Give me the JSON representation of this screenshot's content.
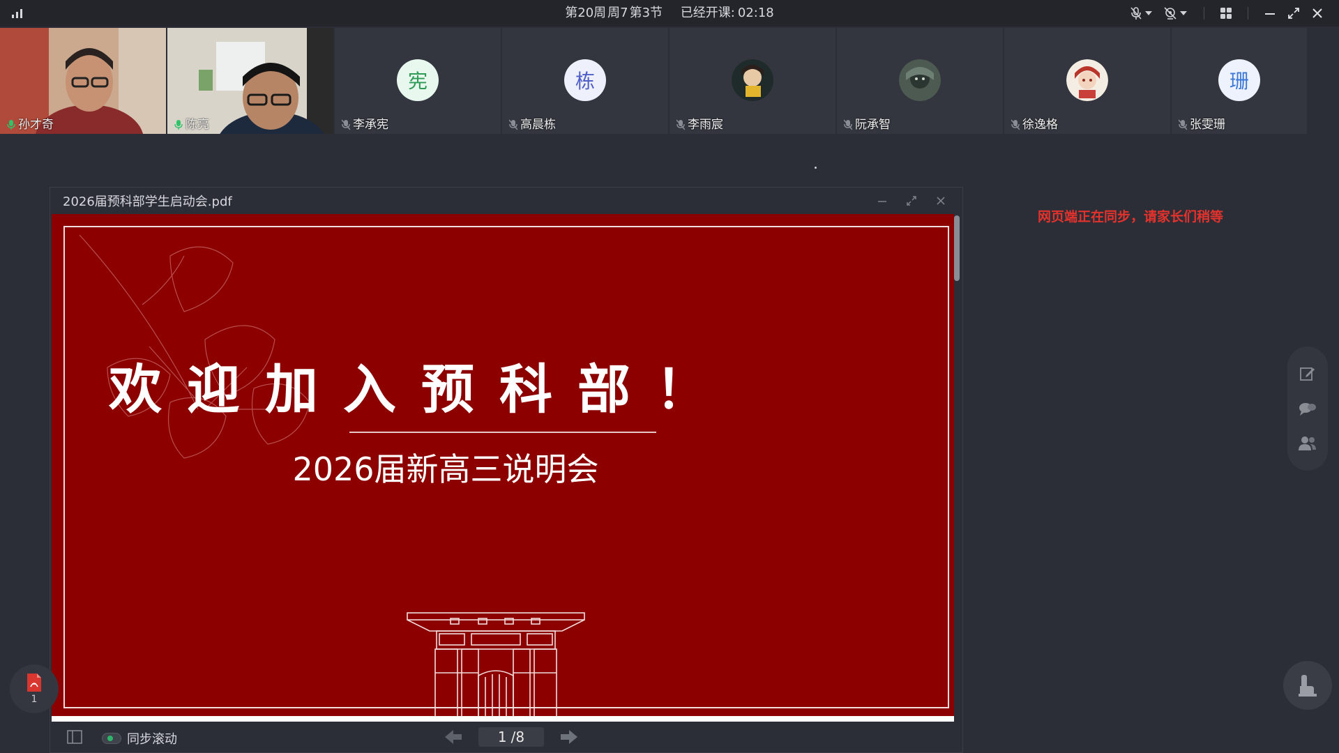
{
  "topbar": {
    "week": "第20周",
    "day": "周7",
    "period": "第3节",
    "elapsed_label": "已经开课:",
    "elapsed_time": "02:18",
    "icons": [
      "signal-icon",
      "mic-off-icon",
      "camera-off-icon",
      "grid-layout-icon",
      "minimize-icon",
      "restore-icon",
      "close-icon"
    ]
  },
  "participants": [
    {
      "name": "孙才奇",
      "type": "video",
      "mic": "on"
    },
    {
      "name": "陈亮",
      "type": "video",
      "mic": "on"
    },
    {
      "name": "李承宪",
      "type": "letter",
      "letter": "宪",
      "bg": "#e8f8ee",
      "fg": "#2e9a55",
      "mic": "off"
    },
    {
      "name": "高晨栋",
      "type": "letter",
      "letter": "栋",
      "bg": "#eef0fb",
      "fg": "#4f5fc7",
      "mic": "off"
    },
    {
      "name": "李雨宸",
      "type": "photo",
      "mic": "off"
    },
    {
      "name": "阮承智",
      "type": "photo",
      "mic": "off"
    },
    {
      "name": "徐逸格",
      "type": "photo",
      "mic": "off"
    },
    {
      "name": "张雯珊",
      "type": "letter",
      "letter": "珊",
      "bg": "#eef2fc",
      "fg": "#3c78d8",
      "mic": "off"
    }
  ],
  "pdf": {
    "filename": "2026届预科部学生启动会.pdf",
    "slide_title": "欢迎加入预科部！",
    "slide_subtitle": "2026届新高三说明会",
    "sync_label": "同步滚动",
    "current_page": "1",
    "page_sep": "/8"
  },
  "sync_note": "网页端正在同步，请家长们稍等",
  "pdf_float_count": "1",
  "colors": {
    "slide_bg": "#8c0000",
    "note": "#e5322d",
    "toggle_on": "#2fb36a"
  }
}
